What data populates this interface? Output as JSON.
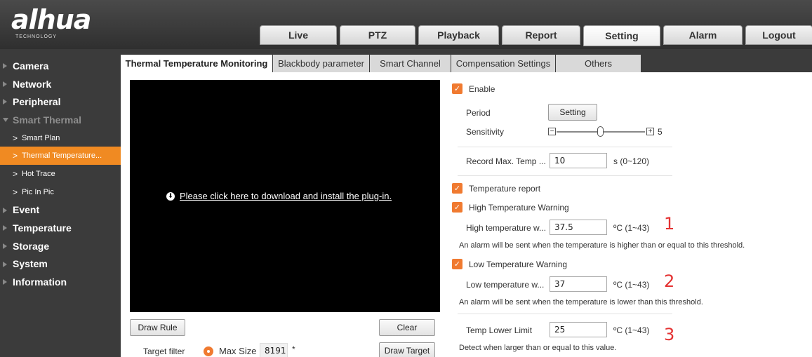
{
  "logo": {
    "brand": "alhua",
    "tagline": "TECHNOLOGY"
  },
  "nav": {
    "tabs": [
      {
        "label": "Live"
      },
      {
        "label": "PTZ"
      },
      {
        "label": "Playback"
      },
      {
        "label": "Report"
      },
      {
        "label": "Setting",
        "active": true
      },
      {
        "label": "Alarm"
      },
      {
        "label": "Logout"
      }
    ]
  },
  "sidebar": {
    "camera": "Camera",
    "network": "Network",
    "peripheral": "Peripheral",
    "smart_thermal": "Smart Thermal",
    "smart_plan": "Smart Plan",
    "thermal_temperature": "Thermal Temperature...",
    "hot_trace": "Hot Trace",
    "pic_in_pic": "Pic In Pic",
    "event": "Event",
    "temperature": "Temperature",
    "storage": "Storage",
    "system": "System",
    "information": "Information"
  },
  "subtabs": {
    "thermal_monitoring": "Thermal Temperature Monitoring",
    "blackbody": "Blackbody parameter",
    "smart_channel": "Smart Channel",
    "compensation": "Compensation Settings",
    "others": "Others"
  },
  "video": {
    "plugin_text": "Please click here to download and install the plug-in."
  },
  "buttons": {
    "draw_rule": "Draw Rule",
    "clear": "Clear",
    "draw_target": "Draw Target",
    "period_setting": "Setting"
  },
  "target_filter": {
    "label": "Target filter",
    "option": "Max Size",
    "value": "8191",
    "asterisk": "*"
  },
  "settings": {
    "enable": "Enable",
    "period": "Period",
    "sensitivity": "Sensitivity",
    "sensitivity_value": "5",
    "sensitivity_level": 0.5,
    "record_max_temp_label": "Record Max. Temp ...",
    "record_max_temp_value": "10",
    "record_max_temp_range": "s (0~120)",
    "temperature_report": "Temperature report",
    "high_warning": "High Temperature Warning",
    "high_label": "High temperature w...",
    "high_value": "37.5",
    "high_unit": "ºC (1~43)",
    "high_note": "An alarm will be sent when the temperature is higher than or equal to this threshold.",
    "low_warning": "Low Temperature Warning",
    "low_label": "Low temperature w...",
    "low_value": "37",
    "low_unit": "ºC (1~43)",
    "low_note": "An alarm will be sent when the temperature is lower than this threshold.",
    "lower_limit_label": "Temp Lower Limit",
    "lower_limit_value": "25",
    "lower_limit_unit": "ºC (1~43)",
    "lower_limit_note": "Detect when larger than or equal to this value."
  },
  "annotations": {
    "one": "1",
    "two": "2",
    "three": "3"
  },
  "colors": {
    "accent": "#f08a22",
    "checkbox": "#f07a30",
    "annotation": "#e43232",
    "header": "#3b3b3b"
  }
}
